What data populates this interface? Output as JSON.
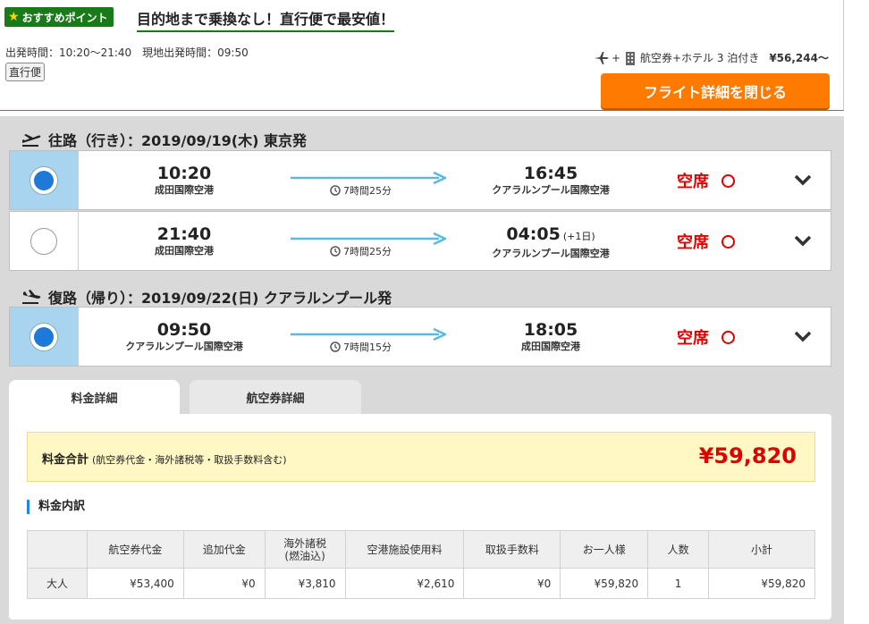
{
  "top": {
    "badge": "おすすめポイント",
    "headline": "目的地まで乗換なし！直行便で最安値！",
    "time_info": "出発時間：10:20〜21:40　現地出発時間：09:50",
    "direct_tag": "直行便",
    "package_label": "航空券+ホテル 3 泊付き",
    "package_price": "¥56,244〜",
    "close_button": "フライト詳細を閉じる"
  },
  "outbound": {
    "title": "往路（行き）：2019/09/19(木) 東京発",
    "flights": [
      {
        "dep_time": "10:20",
        "dep_airport": "成田国際空港",
        "duration": "7時間25分",
        "arr_time": "16:45",
        "arr_plus": "",
        "arr_airport": "クアラルンプール国際空港",
        "seat": "空席",
        "selected": true
      },
      {
        "dep_time": "21:40",
        "dep_airport": "成田国際空港",
        "duration": "7時間25分",
        "arr_time": "04:05",
        "arr_plus": "(+1日)",
        "arr_airport": "クアラルンプール国際空港",
        "seat": "空席",
        "selected": false
      }
    ]
  },
  "inbound": {
    "title": "復路（帰り）：2019/09/22(日) クアラルンプール発",
    "flights": [
      {
        "dep_time": "09:50",
        "dep_airport": "クアラルンプール国際空港",
        "duration": "7時間15分",
        "arr_time": "18:05",
        "arr_plus": "",
        "arr_airport": "成田国際空港",
        "seat": "空席",
        "selected": true
      }
    ]
  },
  "tabs": {
    "fare": "料金詳細",
    "ticket": "航空券詳細"
  },
  "total": {
    "label": "料金合計",
    "sub": "(航空券代金・海外諸税等・取扱手数料含む)",
    "price": "¥59,820"
  },
  "breakdown": {
    "section_label": "料金内訳",
    "headers": [
      "",
      "航空券代金",
      "追加代金",
      "海外諸税\n(燃油込)",
      "空港施設使用料",
      "取扱手数料",
      "お一人様",
      "人数",
      "小計"
    ],
    "row": [
      "大人",
      "¥53,400",
      "¥0",
      "¥3,810",
      "¥2,610",
      "¥0",
      "¥59,820",
      "1",
      "¥59,820"
    ]
  },
  "colors": {
    "accent_orange": "#ff7a00",
    "seat_red": "#e00000",
    "selected_blue": "#a9d4f0",
    "badge_green": "#1a7a1a"
  }
}
